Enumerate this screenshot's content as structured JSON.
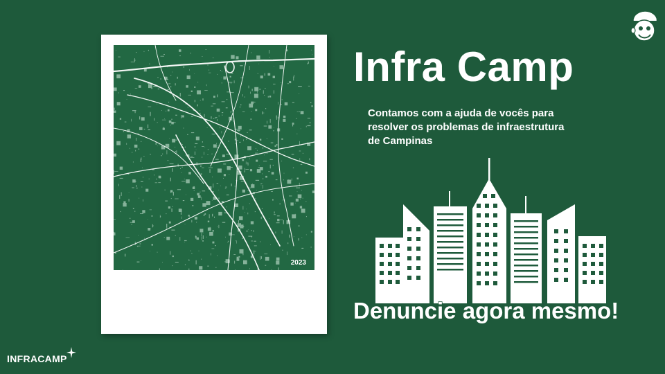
{
  "slide": {
    "title": "Infra Camp",
    "subtitle": "Contamos com a ajuda de vocês para resolver os problemas de infraestrutura de Campinas",
    "cta": "Denuncie agora mesmo!",
    "poster": {
      "year": "2023"
    },
    "logo": {
      "text": "INFRACAMP",
      "icon": "sparkle-icon"
    },
    "mascot": {
      "icon": "mascot-face-icon"
    },
    "illustration": {
      "icon": "city-skyline-icon"
    }
  },
  "colors": {
    "background": "#1e5a3b",
    "map_background": "#226843",
    "text": "#ffffff"
  }
}
